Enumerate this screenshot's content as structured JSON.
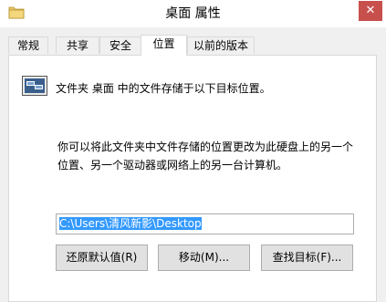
{
  "window": {
    "title": "桌面 属性",
    "close_glyph": "✕"
  },
  "tabs": [
    {
      "label": "常规"
    },
    {
      "label": "共享"
    },
    {
      "label": "安全"
    },
    {
      "label": "位置",
      "active": true
    },
    {
      "label": "以前的版本"
    }
  ],
  "location": {
    "description": "文件夹 桌面 中的文件存储于以下目标位置。",
    "info_line1": "你可以将此文件夹中文件存储的位置更改为此硬盘上的另一个",
    "info_line2": "位置、另一个驱动器或网络上的另一台计算机。",
    "path_value": "C:\\Users\\清风新影\\Desktop"
  },
  "buttons": {
    "restore_default": "还原默认值(R)",
    "move": "移动(M)...",
    "find_target": "查找目标(F)..."
  },
  "colors": {
    "accent_selection": "#3399ff",
    "close_button": "#c7504d"
  }
}
